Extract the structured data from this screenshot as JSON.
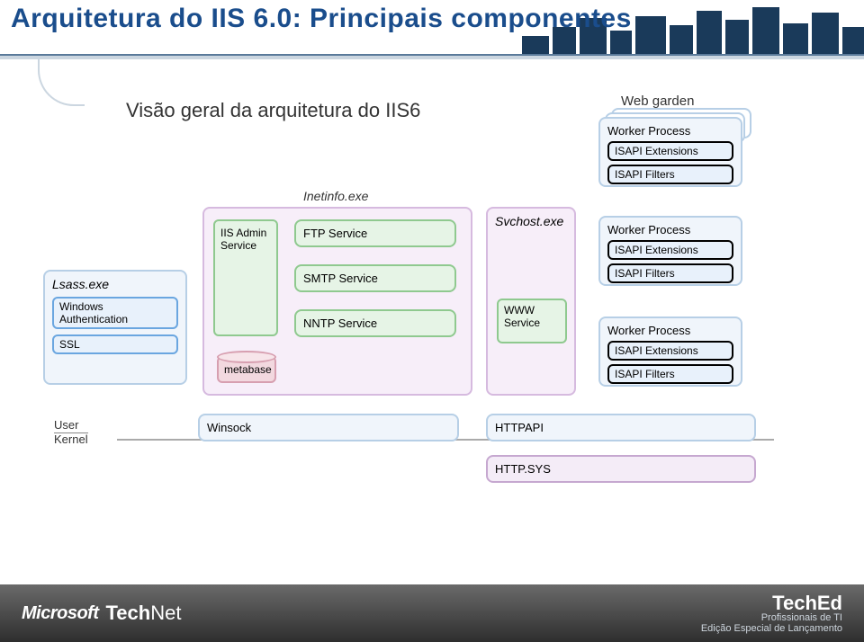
{
  "header": {
    "title": "Arquitetura do IIS 6.0: Principais componentes"
  },
  "subtitle": "Visão geral da arquitetura do IIS6",
  "web_garden_label": "Web garden",
  "worker_process": {
    "title": "Worker Process",
    "isapi_ext": "ISAPI Extensions",
    "isapi_flt": "ISAPI Filters"
  },
  "inetinfo": {
    "label": "Inetinfo.exe",
    "iis_admin": "IIS Admin Service",
    "ftp": "FTP Service",
    "smtp": "SMTP Service",
    "nntp": "NNTP Service",
    "metabase": "metabase"
  },
  "svchost": {
    "label": "Svchost.exe",
    "www": "WWW Service"
  },
  "lsass": {
    "label": "Lsass.exe",
    "winauth": "Windows Authentication",
    "ssl": "SSL"
  },
  "bottom": {
    "user": "User",
    "kernel": "Kernel",
    "winsock": "Winsock",
    "httpapi": "HTTPAPI",
    "httpsys": "HTTP.SYS"
  },
  "footer": {
    "ms": "Microsoft",
    "technet_a": "Tech",
    "technet_b": "Net",
    "teched_brand": "TechEd",
    "teched_line1": "Profissionais de TI",
    "teched_line2": "Edição Especial de Lançamento"
  }
}
